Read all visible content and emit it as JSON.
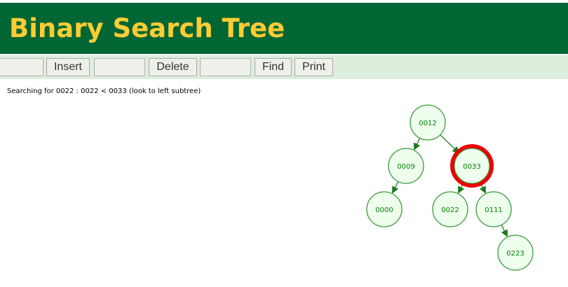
{
  "header": {
    "title": "Binary Search Tree"
  },
  "toolbar": {
    "insert_input": "",
    "insert_label": "Insert",
    "delete_input": "",
    "delete_label": "Delete",
    "find_input": "",
    "find_label": "Find",
    "print_label": "Print"
  },
  "status": {
    "message": "Searching for 0022 : 0022 < 0033 (look to left subtree)"
  },
  "tree": {
    "nodes": [
      {
        "id": "n12",
        "label": "0012",
        "highlighted": false
      },
      {
        "id": "n9",
        "label": "0009",
        "highlighted": false
      },
      {
        "id": "n33",
        "label": "0033",
        "highlighted": true
      },
      {
        "id": "n0",
        "label": "0000",
        "highlighted": false
      },
      {
        "id": "n22",
        "label": "0022",
        "highlighted": false
      },
      {
        "id": "n111",
        "label": "0111",
        "highlighted": false
      },
      {
        "id": "n223",
        "label": "0223",
        "highlighted": false
      }
    ],
    "edges": [
      {
        "from": "n12",
        "to": "n9"
      },
      {
        "from": "n12",
        "to": "n33"
      },
      {
        "from": "n9",
        "to": "n0"
      },
      {
        "from": "n33",
        "to": "n22"
      },
      {
        "from": "n33",
        "to": "n111"
      },
      {
        "from": "n111",
        "to": "n223"
      }
    ]
  },
  "colors": {
    "header_bg": "#006633",
    "header_text": "#ffcc33",
    "toolbar_bg": "#ddeedd",
    "node_fill": "#eeffee",
    "node_stroke": "#3b9a3b",
    "node_text": "#008000",
    "edge": "#1a7a1a",
    "highlight": "#ee0000"
  }
}
